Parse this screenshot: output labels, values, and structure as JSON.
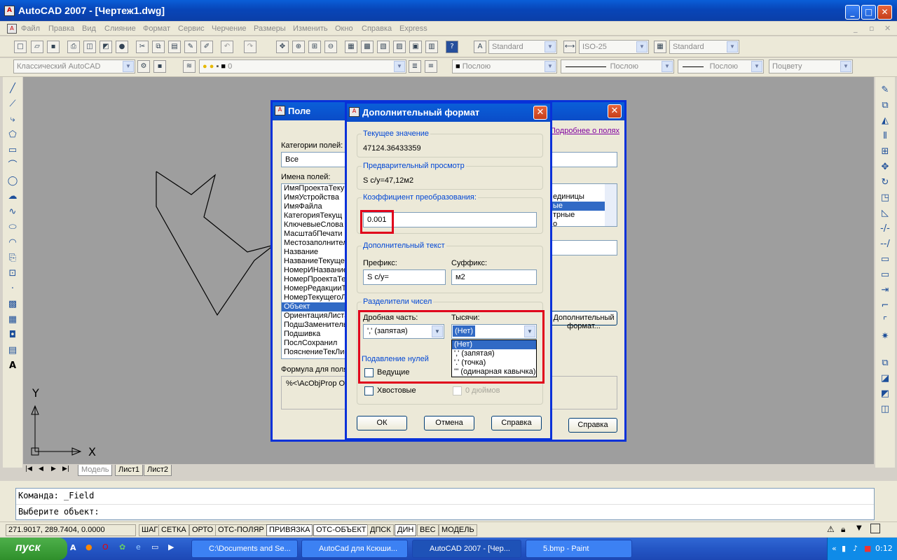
{
  "window": {
    "title": "AutoCAD 2007 - [Чертеж1.dwg]"
  },
  "menu": [
    "Файл",
    "Правка",
    "Вид",
    "Слияние",
    "Формат",
    "Сервис",
    "Черчение",
    "Размеры",
    "Изменить",
    "Окно",
    "Справка",
    "Express"
  ],
  "toolbar": {
    "text_style": "Standard",
    "dim_style": "ISO-25",
    "table_style": "Standard",
    "workspace": "Классический AutoCAD",
    "layer": "0",
    "color": "Послою",
    "linetype": "Послою",
    "lineweight": "Послою",
    "plotstyle": "Поцвету"
  },
  "tabs": [
    "Модель",
    "Лист1",
    "Лист2"
  ],
  "command": {
    "line1": "Команда: _Field",
    "line2": "Выберите объект:"
  },
  "status": {
    "coords": "271.9017, 289.7404, 0.0000",
    "buttons": [
      "ШАГ",
      "СЕТКА",
      "ОРТО",
      "ОТС-ПОЛЯР",
      "ПРИВЯЗКА",
      "ОТС-ОБЪЕКТ",
      "ДПСК",
      "ДИН",
      "ВЕС",
      "МОДЕЛЬ"
    ]
  },
  "axes": {
    "y": "Y",
    "x": "X"
  },
  "field_dialog": {
    "title": "Поле",
    "categories_label": "Категории полей:",
    "categories_value": "Все",
    "names_label": "Имена полей:",
    "names": [
      "ИмяПроектаТекущ",
      "ИмяУстройства",
      "ИмяФайла",
      "КатегорияТекущ",
      "КлючевыеСлова",
      "МасштабПечати",
      "Местозаполнител",
      "Название",
      "НазваниеТекуще",
      "НомерИНазвание",
      "НомерПроектаТе",
      "НомерРедакцииТ",
      "НомерТекущегоЛ",
      "Объект",
      "ОриентацияЛиста",
      "ПодшЗаменитель",
      "Подшивка",
      "ПослСохранил",
      "ПояснениеТекЛис"
    ],
    "selected_name": "Объект",
    "more_link": "Подробнее о полях",
    "right_list": [
      "единицы",
      "ые",
      "трные",
      "о"
    ],
    "more_format_btn": "Дополнительный формат...",
    "formula_label": "Формула для поля:",
    "formula_value": "%<\\AcObjProp O",
    "help_btn": "Справка"
  },
  "format_dialog": {
    "title": "Дополнительный формат",
    "current_value_label": "Текущее значение",
    "current_value": "47124.36433359",
    "preview_label": "Предварительный просмотр",
    "preview_value": "S с/у=47,12м2",
    "factor_label": "Коэффициент преобразования:",
    "factor_value": "0.001",
    "addtext_label": "Дополнительный текст",
    "prefix_label": "Префикс:",
    "prefix_value": "S с/у=",
    "suffix_label": "Суффикс:",
    "suffix_value": "м2",
    "separators_label": "Разделители чисел",
    "decimal_label": "Дробная часть:",
    "decimal_value": "',' (запятая)",
    "thousands_label": "Тысячи:",
    "thousands_value": "(Нет)",
    "thousands_options": [
      "(Нет)",
      "',' (запятая)",
      "'.' (точка)",
      "''' (одинарная кавычка)"
    ],
    "zero_suppression_label": "Подавление нулей",
    "leading_label": "Ведущие",
    "trailing_label": "Хвостовые",
    "inches_label": "0 дюймов",
    "ok_btn": "ОК",
    "cancel_btn": "Отмена",
    "help_btn": "Справка"
  },
  "taskbar": {
    "start": "пуск",
    "tasks": [
      "C:\\Documents and Se...",
      "AutoCad для Ксюши...",
      "AutoCAD 2007 - [Чер...",
      "5.bmp - Paint"
    ],
    "clock": "0:12"
  },
  "colors": {
    "titlebar": "#0a4cc8",
    "highlight_box": "#e0001b",
    "canvas": "#9e9e9e",
    "selection": "#316ac5"
  }
}
